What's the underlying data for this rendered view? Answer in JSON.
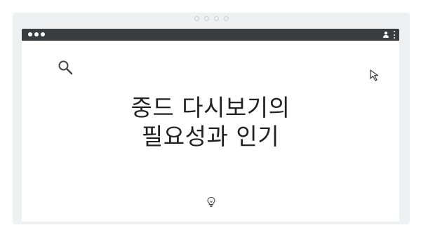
{
  "window": {
    "icons": {
      "top_dots": "page-indicator-dots",
      "user": "user-icon",
      "menu": "more-vert-icon"
    }
  },
  "content": {
    "headline_line1": "중드 다시보기의",
    "headline_line2": "필요성과 인기",
    "icons": {
      "search": "search-icon",
      "cursor": "cursor-icon",
      "idea": "lightbulb-icon"
    }
  },
  "colors": {
    "titlebar": "#3a3d40",
    "frame_background": "#eef0f2",
    "content_background": "#ffffff",
    "text": "#222222"
  }
}
